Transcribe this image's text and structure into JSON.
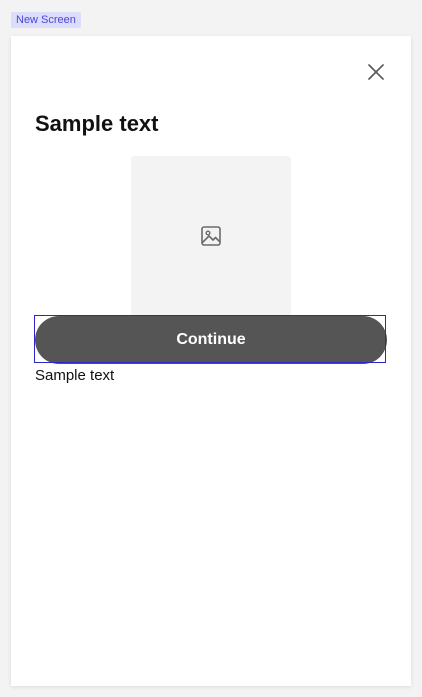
{
  "screen_tag": "New Screen",
  "modal": {
    "title": "Sample text",
    "close_icon": "close-icon",
    "image_icon": "image-icon",
    "continue_label": "Continue",
    "body_text": "Sample text"
  },
  "colors": {
    "tag_bg": "#dcdcfb",
    "tag_text": "#4b46d8",
    "button_bg": "#555555",
    "selection_outline": "#2c25c9",
    "placeholder_bg": "#f3f3f3"
  }
}
